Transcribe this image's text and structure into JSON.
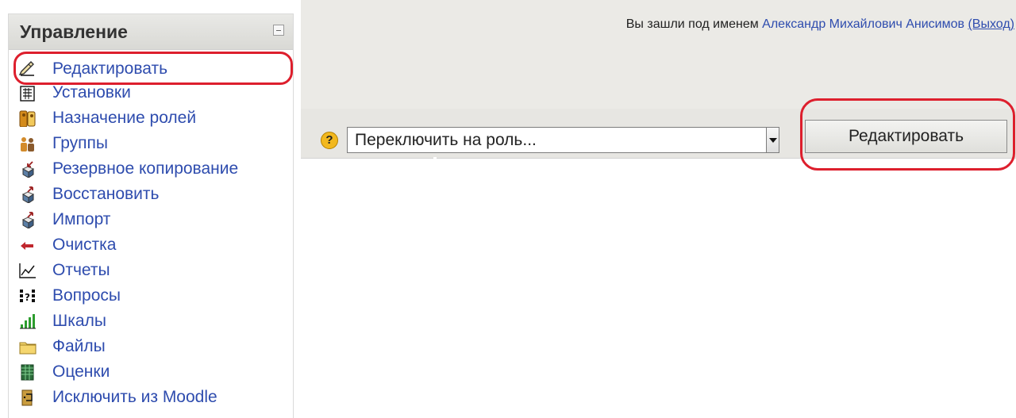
{
  "sidebar": {
    "title": "Управление",
    "items": [
      {
        "label": "Редактировать",
        "icon": "pen-icon"
      },
      {
        "label": "Установки",
        "icon": "settings-icon"
      },
      {
        "label": "Назначение ролей",
        "icon": "roles-icon"
      },
      {
        "label": "Группы",
        "icon": "groups-icon"
      },
      {
        "label": "Резервное копирование",
        "icon": "backup-icon"
      },
      {
        "label": "Восстановить",
        "icon": "restore-icon"
      },
      {
        "label": "Импорт",
        "icon": "import-icon"
      },
      {
        "label": "Очистка",
        "icon": "reset-icon"
      },
      {
        "label": "Отчеты",
        "icon": "reports-icon"
      },
      {
        "label": "Вопросы",
        "icon": "questions-icon"
      },
      {
        "label": "Шкалы",
        "icon": "scales-icon"
      },
      {
        "label": "Файлы",
        "icon": "folder-icon"
      },
      {
        "label": "Оценки",
        "icon": "grades-icon"
      },
      {
        "label": "Исключить из Moodle",
        "icon": "exit-icon"
      }
    ]
  },
  "header": {
    "login_prefix": "Вы зашли под именем ",
    "user_name": "Александр Михайлович Анисимов",
    "logout_text": "(Выход)"
  },
  "role_switch": {
    "selected": "Переключить на роль..."
  },
  "edit_button": {
    "label": "Редактировать"
  },
  "colors": {
    "link": "#2e4cae",
    "highlight": "#dd1f2d",
    "band": "#ebeae6"
  }
}
